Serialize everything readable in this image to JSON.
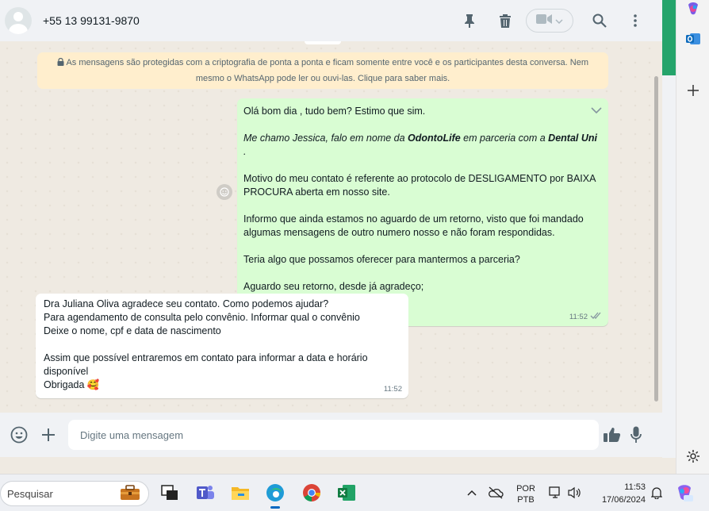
{
  "header": {
    "contact": "+55 13 99131-9870",
    "icons": [
      "pin-icon",
      "trash-icon",
      "video-icon",
      "search-icon",
      "menu-icon"
    ]
  },
  "chat": {
    "encryption_notice": "As mensagens são protegidas com a criptografia de ponta a ponta e ficam somente entre você e os participantes desta conversa. Nem mesmo o WhatsApp pode ler ou ouvi-las. Clique para saber mais.",
    "outgoing": {
      "p1": "Olá bom dia , tudo bem? Estimo que sim.",
      "p2a": "Me chamo Jessica, falo em nome da ",
      "p2b": "OdontoLife",
      "p2c": " em parceria com a ",
      "p2d": "Dental Uni",
      "p2e": " .",
      "p3": "Motivo do meu contato é referente ao protocolo de DESLIGAMENTO por BAIXA PROCURA aberta em nosso site.",
      "p4": "Informo que ainda estamos no aguardo de um retorno, visto que foi mandado algumas mensagens de outro numero nosso e não foram respondidas.",
      "p5": "Teria algo que possamos oferecer para mantermos a parceria?",
      "p6": "Aguardo seu retorno, desde já agradeço;",
      "time": "11:52"
    },
    "incoming": {
      "l1": "Dra Juliana Oliva agradece seu contato. Como podemos ajudar?",
      "l2": "Para agendamento de consulta pelo convênio. Informar qual o convênio",
      "l3": "Deixe  o nome, cpf e data de nascimento",
      "l4": "Assim que possível entraremos em contato para informar a data e horário disponível",
      "l5": "Obrigada",
      "emoji": "🥰",
      "time": "11:52"
    }
  },
  "composer": {
    "placeholder": "Digite uma mensagem"
  },
  "taskbar": {
    "search_label": "Pesquisar",
    "lang_top": "POR",
    "lang_bottom": "PTB",
    "time": "11:53",
    "date": "17/06/2024"
  },
  "colors": {
    "outgoing_bubble": "#d9fdd3",
    "notice_bg": "#ffeecd",
    "brand_green": "#25a46b"
  }
}
